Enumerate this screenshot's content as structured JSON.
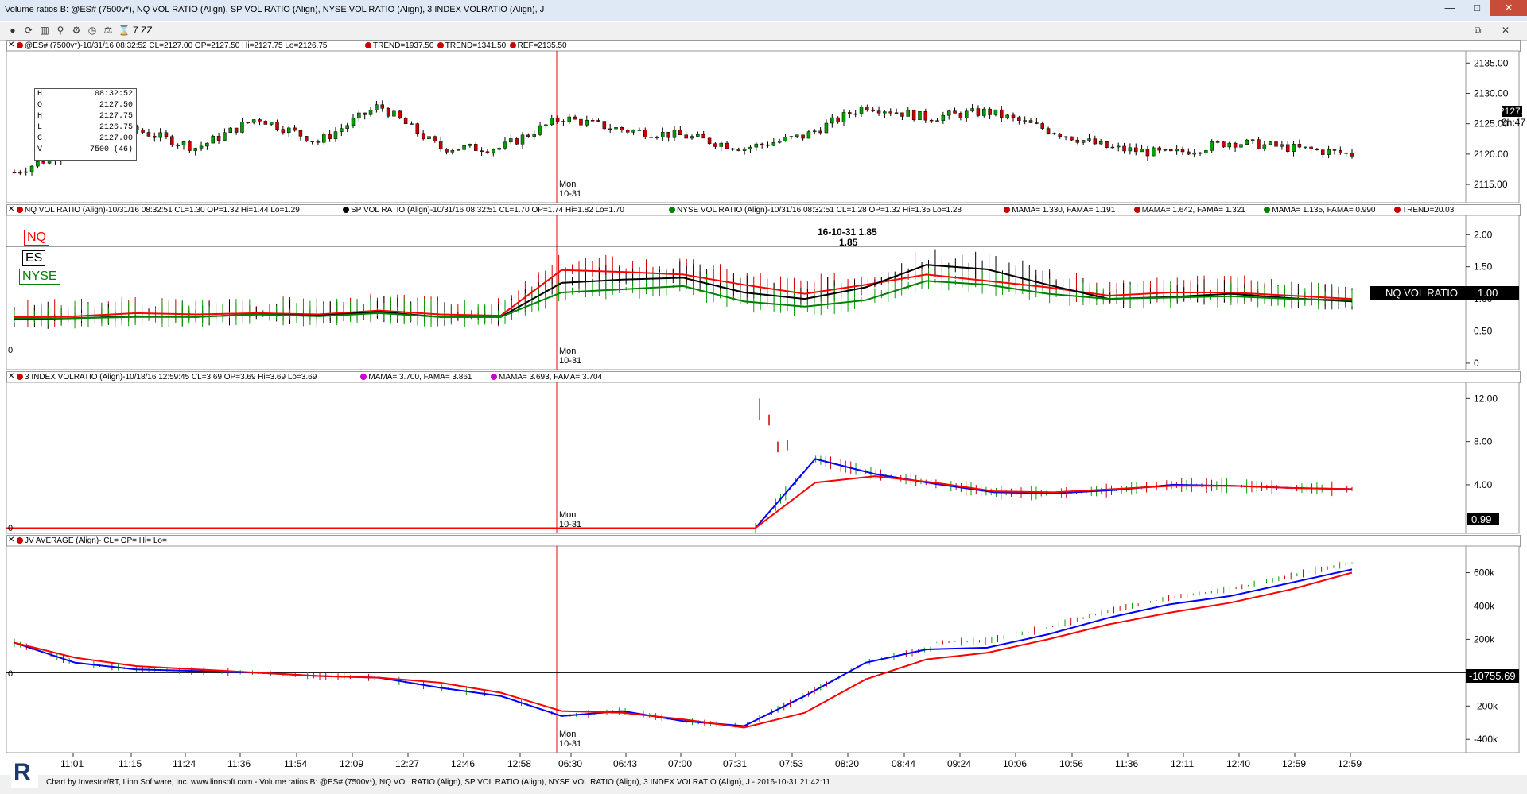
{
  "window": {
    "title": "Volume ratios B: @ES# (7500v*), NQ VOL RATIO (Align), SP VOL RATIO (Align), NYSE VOL RATIO (Align), 3 INDEX VOLRATIO (Align), J",
    "controls": [
      "minimize",
      "maximize",
      "close"
    ]
  },
  "toolbar": {
    "icons": [
      "circle-icon",
      "refresh-icon",
      "chart-icon",
      "zoom-icon",
      "settings-icon",
      "clock-icon",
      "scale-icon",
      "hourglass-icon"
    ],
    "zoom_label": "7 ZZ",
    "restore_symbol": "⧉",
    "close_symbol": "✕"
  },
  "panes": [
    {
      "id": "es",
      "header": [
        {
          "text": "@ES# (7500v*)-10/31/16 08:32:52 CL=2127.00 OP=2127.50 Hi=2127.75 Lo=2126.75",
          "color": "#cc0000"
        },
        {
          "text": "TREND=1937.50",
          "color": "#cc0000"
        },
        {
          "text": "TREND=1341.50",
          "color": "#cc0000"
        },
        {
          "text": "REF=2135.50",
          "color": "#cc0000"
        }
      ],
      "axis": {
        "min": 2112,
        "max": 2137,
        "ticks": [
          2135,
          2130,
          2125,
          2120,
          2115
        ],
        "tick_labels": [
          "2135.00",
          "2130.00",
          "2125.00",
          "2120.00",
          "2115.00"
        ]
      },
      "last_price": "2127.50",
      "time_left": "8h:47",
      "ohlc_box": {
        "rows": [
          [
            "H",
            "08:32:52"
          ],
          [
            "O",
            "2127.50"
          ],
          [
            "H",
            "2127.75"
          ],
          [
            "L",
            "2126.75"
          ],
          [
            "C",
            "2127.00"
          ],
          [
            "V",
            "7500 (46)"
          ]
        ]
      },
      "session_label": [
        "Mon",
        "10-31"
      ]
    },
    {
      "id": "ratios",
      "header": [
        {
          "text": "NQ VOL RATIO (Align)-10/31/16 08:32:51 CL=1.30 OP=1.32 Hi=1.44 Lo=1.29",
          "color": "#cc0000"
        },
        {
          "text": "SP VOL RATIO (Align)-10/31/16 08:32:51 CL=1.70 OP=1.74 Hi=1.82 Lo=1.70",
          "color": "#000000"
        },
        {
          "text": "NYSE VOL RATIO (Align)-10/31/16 08:32:51 CL=1.28 OP=1.32 Hi=1.35 Lo=1.28",
          "color": "#008000"
        },
        {
          "text": "MAMA=  1.330, FAMA=  1.191",
          "color": "#cc0000"
        },
        {
          "text": "MAMA=  1.642, FAMA=  1.321",
          "color": "#cc0000"
        },
        {
          "text": "MAMA=  1.135, FAMA=  0.990",
          "color": "#008000"
        },
        {
          "text": "TREND=20.03",
          "color": "#cc0000"
        }
      ],
      "axis": {
        "min": -0.1,
        "max": 2.3,
        "ticks": [
          2.0,
          1.5,
          1.0,
          0.5,
          0.0
        ],
        "tick_labels": [
          "2.00",
          "1.50",
          "1.00",
          "0.50",
          "0"
        ]
      },
      "legend": [
        {
          "label": "NQ",
          "color": "#ff0000"
        },
        {
          "label": "ES",
          "color": "#000000"
        },
        {
          "label": "NYSE",
          "color": "#008000"
        }
      ],
      "annotation": {
        "text": "16-10-31  1.85",
        "value": "1.85"
      },
      "zero_label": "0",
      "last_value": "1.00",
      "last_label": "NQ VOL RATIO",
      "session_label": [
        "Mon",
        "10-31"
      ]
    },
    {
      "id": "index3",
      "header": [
        {
          "text": "3 INDEX VOLRATIO (Align)-10/18/16 12:59:45 CL=3.69 OP=3.69 Hi=3.69 Lo=3.69",
          "color": "#cc0000"
        },
        {
          "text": "MAMA=  3.700, FAMA=  3.861",
          "color": "#cc00cc"
        },
        {
          "text": "MAMA=  3.693, FAMA=  3.704",
          "color": "#cc00cc"
        }
      ],
      "axis": {
        "min": -0.5,
        "max": 13.5,
        "ticks": [
          12,
          8,
          4
        ],
        "tick_labels": [
          "12.00",
          "8.00",
          "4.00"
        ]
      },
      "zero_label": "0",
      "last_value": "0.99",
      "session_label": [
        "Mon",
        "10-31"
      ]
    },
    {
      "id": "jv",
      "header": [
        {
          "text": "JV AVERAGE (Align)- CL= OP= Hi= Lo=",
          "color": "#cc0000"
        }
      ],
      "axis": {
        "min": -480000,
        "max": 760000,
        "ticks": [
          600000,
          400000,
          200000,
          -200000,
          -400000
        ],
        "tick_labels": [
          "600k",
          "400k",
          "200k",
          "-200k",
          "-400k"
        ]
      },
      "zero_label": "0",
      "last_value": "-10755.69",
      "session_label": [
        "Mon",
        "10-31"
      ]
    }
  ],
  "time_axis": [
    "11:01",
    "11:15",
    "11:24",
    "11:36",
    "11:54",
    "12:09",
    "12:27",
    "12:46",
    "12:58",
    "06:30",
    "06:43",
    "07:00",
    "07:31",
    "07:53",
    "08:20",
    "08:44",
    "09:24",
    "10:06",
    "10:56",
    "11:36",
    "12:11",
    "12:40",
    "12:59",
    "12:59"
  ],
  "status": {
    "text": "Chart by Investor/RT, Linn Software, Inc. www.linnsoft.com - Volume ratios B: @ES# (7500v*), NQ VOL RATIO (Align), SP VOL RATIO (Align), NYSE VOL RATIO (Align), 3 INDEX VOLRATIO (Align), J - 2016-10-31 21:42:11",
    "logo_letter": "R"
  },
  "colors": {
    "up": "#00a000",
    "down": "#cc0000",
    "session_line": "#ff0000",
    "mama_blue": "#0000ff",
    "background": "#ffffff"
  },
  "chart_data": [
    {
      "type": "line",
      "title": "@ES# (7500v*)",
      "x": [
        "11:01",
        "11:15",
        "11:24",
        "11:36",
        "11:54",
        "12:09",
        "12:27",
        "12:46",
        "12:58",
        "06:30",
        "06:43",
        "07:00",
        "07:31",
        "07:53",
        "08:20",
        "08:44",
        "09:24",
        "10:06",
        "10:56",
        "11:36",
        "12:11",
        "12:40",
        "12:59"
      ],
      "series": [
        {
          "name": "@ES#",
          "values": [
            2117,
            2121,
            2124,
            2121,
            2126,
            2122,
            2128,
            2121,
            2121,
            2126,
            2124,
            2123,
            2121,
            2123,
            2128,
            2126,
            2127,
            2124,
            2121,
            2120,
            2122,
            2121,
            2120
          ]
        }
      ],
      "ylim": [
        2112,
        2137
      ],
      "reference_line": 2135.5
    },
    {
      "type": "line",
      "title": "Volume ratios",
      "x": [
        "11:01",
        "11:15",
        "11:24",
        "11:36",
        "11:54",
        "12:09",
        "12:27",
        "12:46",
        "12:58",
        "06:30",
        "06:43",
        "07:00",
        "07:31",
        "07:53",
        "08:20",
        "08:44",
        "09:24",
        "10:06",
        "10:56",
        "11:36",
        "12:11",
        "12:40",
        "12:59"
      ],
      "series": [
        {
          "name": "NQ",
          "values": [
            0.72,
            0.73,
            0.78,
            0.76,
            0.78,
            0.76,
            0.82,
            0.76,
            0.74,
            1.45,
            1.42,
            1.38,
            1.22,
            1.08,
            1.22,
            1.38,
            1.28,
            1.18,
            1.05,
            1.1,
            1.1,
            1.05,
            1.0
          ]
        },
        {
          "name": "ES",
          "values": [
            0.68,
            0.7,
            0.73,
            0.72,
            0.76,
            0.74,
            0.8,
            0.72,
            0.72,
            1.25,
            1.3,
            1.33,
            1.1,
            1.0,
            1.18,
            1.53,
            1.46,
            1.22,
            1.0,
            1.03,
            1.08,
            1.01,
            0.96
          ]
        },
        {
          "name": "NYSE",
          "values": [
            0.7,
            0.7,
            0.72,
            0.72,
            0.76,
            0.73,
            0.78,
            0.72,
            0.72,
            1.1,
            1.15,
            1.2,
            0.96,
            0.88,
            0.98,
            1.28,
            1.22,
            1.08,
            1.0,
            1.02,
            1.04,
            1.0,
            0.98
          ]
        }
      ],
      "ylim": [
        -0.1,
        2.3
      ]
    },
    {
      "type": "line",
      "title": "3 INDEX VOLRATIO",
      "x": [
        "07:31",
        "07:53",
        "08:20",
        "08:44",
        "09:24",
        "10:06",
        "10:56",
        "11:36",
        "12:11",
        "12:40",
        "12:59"
      ],
      "series": [
        {
          "name": "MAMA",
          "values": [
            0.0,
            6.4,
            5.0,
            4.1,
            3.3,
            3.2,
            3.5,
            4.0,
            3.9,
            3.7,
            3.6
          ]
        },
        {
          "name": "FAMA",
          "values": [
            0.0,
            4.2,
            4.8,
            4.2,
            3.4,
            3.3,
            3.6,
            3.9,
            3.9,
            3.7,
            3.6
          ]
        }
      ],
      "ylim": [
        -0.5,
        13.5
      ]
    },
    {
      "type": "line",
      "title": "JV AVERAGE",
      "x": [
        "11:01",
        "11:15",
        "11:24",
        "11:36",
        "11:54",
        "12:09",
        "12:27",
        "12:46",
        "12:58",
        "06:30",
        "06:43",
        "07:00",
        "07:31",
        "07:53",
        "08:20",
        "08:44",
        "09:24",
        "10:06",
        "10:56",
        "11:36",
        "12:11",
        "12:40",
        "12:59"
      ],
      "series": [
        {
          "name": "blue",
          "values": [
            180000,
            60000,
            20000,
            10000,
            0,
            -20000,
            -30000,
            -90000,
            -140000,
            -260000,
            -230000,
            -290000,
            -320000,
            -140000,
            60000,
            140000,
            150000,
            230000,
            330000,
            410000,
            460000,
            540000,
            620000
          ]
        },
        {
          "name": "red",
          "values": [
            180000,
            90000,
            40000,
            20000,
            0,
            -20000,
            -30000,
            -60000,
            -120000,
            -230000,
            -240000,
            -280000,
            -330000,
            -240000,
            -40000,
            80000,
            120000,
            200000,
            290000,
            360000,
            420000,
            500000,
            600000
          ]
        }
      ],
      "ylim": [
        -480000,
        760000
      ]
    }
  ]
}
